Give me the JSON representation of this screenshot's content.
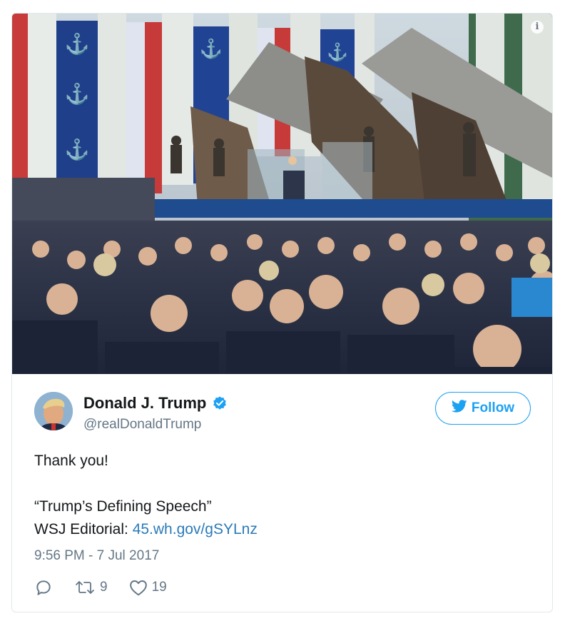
{
  "tweet": {
    "display_name": "Donald J. Trump",
    "handle": "@realDonaldTrump",
    "verified": true,
    "follow_label": "Follow",
    "text_line1": "Thank you!",
    "text_line2": "",
    "text_line3": "“Trump’s Defining Speech”",
    "text_line4_prefix": "WSJ Editorial: ",
    "text_link": "45.wh.gov/gSYLnz",
    "timestamp": "9:56 PM - 7 Jul 2017",
    "retweet_count": "9",
    "like_count": "19"
  },
  "colors": {
    "twitter_blue": "#1da1f2",
    "link_blue": "#2b7bb9",
    "muted_gray": "#657786"
  },
  "icons": {
    "info": "info-icon",
    "verified": "verified-badge-icon",
    "follow_bird": "twitter-bird-icon",
    "reply": "reply-icon",
    "retweet": "retweet-icon",
    "like": "heart-icon"
  }
}
